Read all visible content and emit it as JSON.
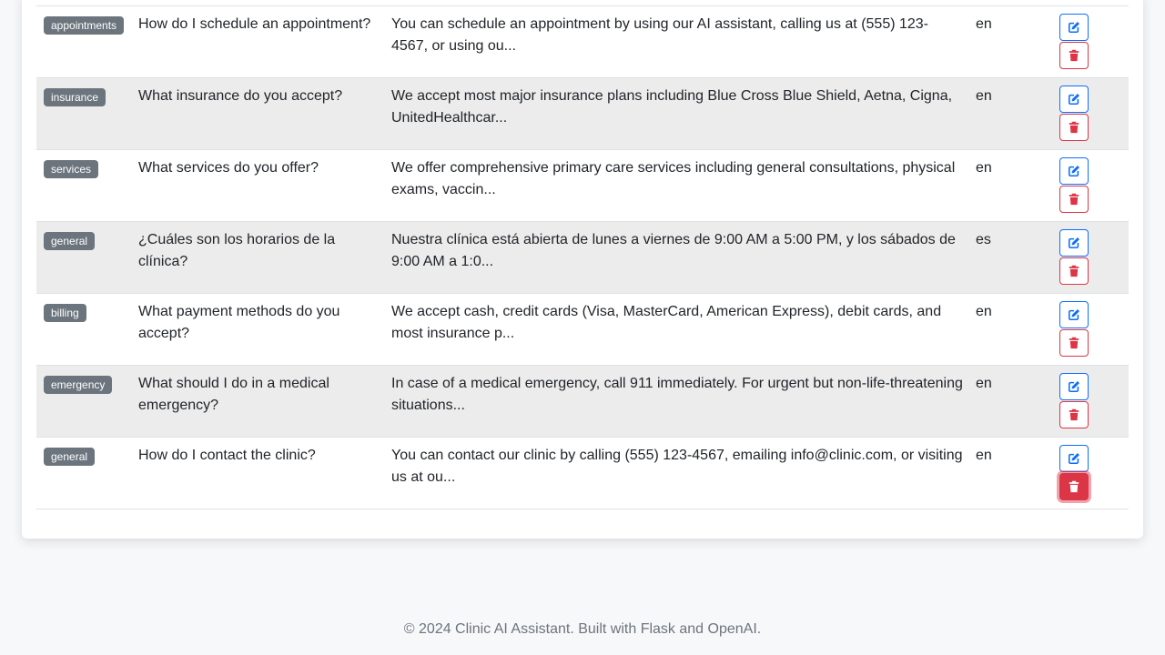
{
  "colors": {
    "primary": "#0d6efd",
    "danger": "#dc3545",
    "badge": "#6c757d"
  },
  "faqs": [
    {
      "category": "appointments",
      "question": "How do I schedule an appointment?",
      "answer": "You can schedule an appointment by using our AI assistant, calling us at (555) 123-4567, or using ou...",
      "language": "en"
    },
    {
      "category": "insurance",
      "question": "What insurance do you accept?",
      "answer": "We accept most major insurance plans including Blue Cross Blue Shield, Aetna, Cigna, UnitedHealthcar...",
      "language": "en"
    },
    {
      "category": "services",
      "question": "What services do you offer?",
      "answer": "We offer comprehensive primary care services including general consultations, physical exams, vaccin...",
      "language": "en"
    },
    {
      "category": "general",
      "question": "¿Cuáles son los horarios de la clínica?",
      "answer": "Nuestra clínica está abierta de lunes a viernes de 9:00 AM a 5:00 PM, y los sábados de 9:00 AM a 1:0...",
      "language": "es"
    },
    {
      "category": "billing",
      "question": "What payment methods do you accept?",
      "answer": "We accept cash, credit cards (Visa, MasterCard, American Express), debit cards, and most insurance p...",
      "language": "en"
    },
    {
      "category": "emergency",
      "question": "What should I do in a medical emergency?",
      "answer": "In case of a medical emergency, call 911 immediately. For urgent but non-life-threatening situations...",
      "language": "en"
    },
    {
      "category": "general",
      "question": "How do I contact the clinic?",
      "answer": "You can contact our clinic by calling (555) 123-4567, emailing info@clinic.com, or visiting us at ou...",
      "language": "en"
    }
  ],
  "icons": {
    "edit": "edit-icon",
    "delete": "trash-icon"
  },
  "footer": {
    "text": "© 2024 Clinic AI Assistant. Built with Flask and OpenAI."
  }
}
